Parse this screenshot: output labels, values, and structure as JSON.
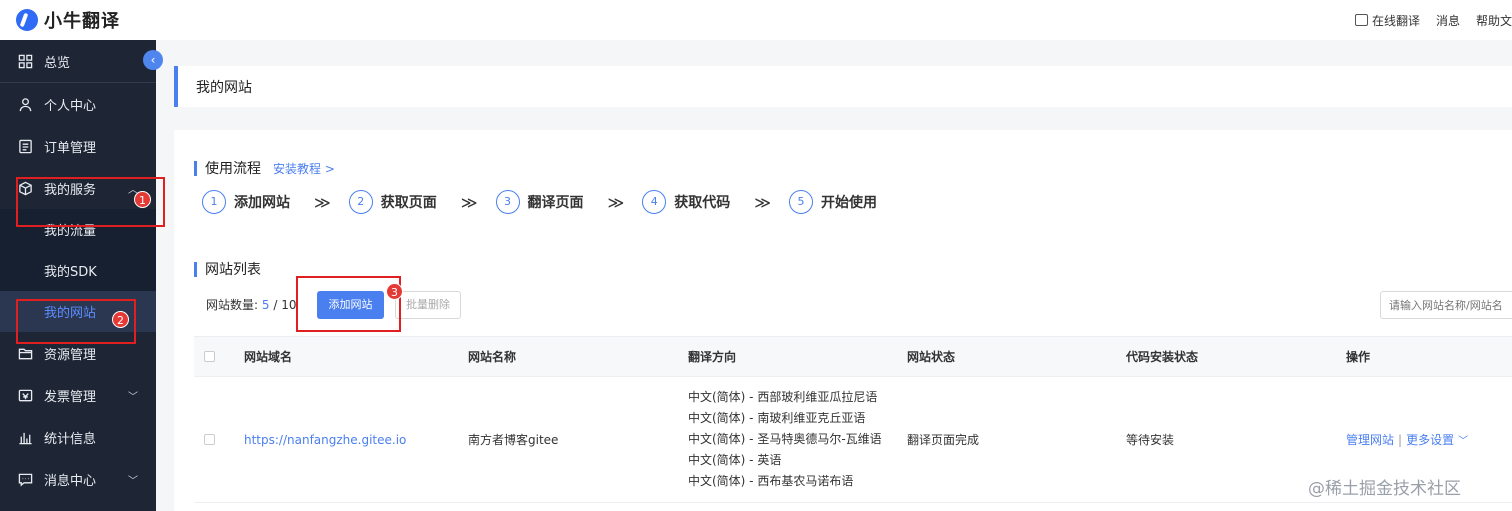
{
  "brand": {
    "name": "小牛翻译"
  },
  "topnav": {
    "online_translate": "在线翻译",
    "messages": "消息",
    "help": "帮助文"
  },
  "sidebar": {
    "items": [
      {
        "label": "总览"
      },
      {
        "label": "个人中心"
      },
      {
        "label": "订单管理"
      },
      {
        "label": "我的服务"
      },
      {
        "label": "资源管理"
      },
      {
        "label": "发票管理"
      },
      {
        "label": "统计信息"
      },
      {
        "label": "消息中心"
      }
    ],
    "sub_items": [
      {
        "label": "我的流量"
      },
      {
        "label": "我的SDK"
      },
      {
        "label": "我的网站"
      }
    ]
  },
  "annotations": {
    "b1": "1",
    "b2": "2",
    "b3": "3"
  },
  "page": {
    "title": "我的网站"
  },
  "process": {
    "title": "使用流程",
    "tutorial_link": "安装教程 >",
    "steps": [
      {
        "num": "1",
        "label": "添加网站"
      },
      {
        "num": "2",
        "label": "获取页面"
      },
      {
        "num": "3",
        "label": "翻译页面"
      },
      {
        "num": "4",
        "label": "获取代码"
      },
      {
        "num": "5",
        "label": "开始使用"
      }
    ],
    "arrow": "≫"
  },
  "site_list": {
    "title": "网站列表",
    "count_label": "网站数量:",
    "count_value": "5",
    "count_total": "/ 10",
    "add_button": "添加网站",
    "batch_delete_button": "批量删除",
    "search_placeholder": "请输入网站名称/网站名",
    "columns": [
      "网站域名",
      "网站名称",
      "翻译方向",
      "网站状态",
      "代码安装状态",
      "操作"
    ],
    "rows": [
      {
        "domain": "https://nanfangzhe.gitee.io",
        "name": "南方者博客gitee",
        "directions": [
          "中文(简体) - 西部玻利维亚瓜拉尼语",
          "中文(简体) - 南玻利维亚克丘亚语",
          "中文(简体) - 圣马特奥德马尔-瓦维语",
          "中文(简体) - 英语",
          "中文(简体) - 西布基农马诺布语"
        ],
        "status": "翻译页面完成",
        "install_status": "等待安装",
        "manage": "管理网站",
        "more": "更多设置"
      }
    ]
  },
  "watermark": "@稀土掘金技术社区"
}
